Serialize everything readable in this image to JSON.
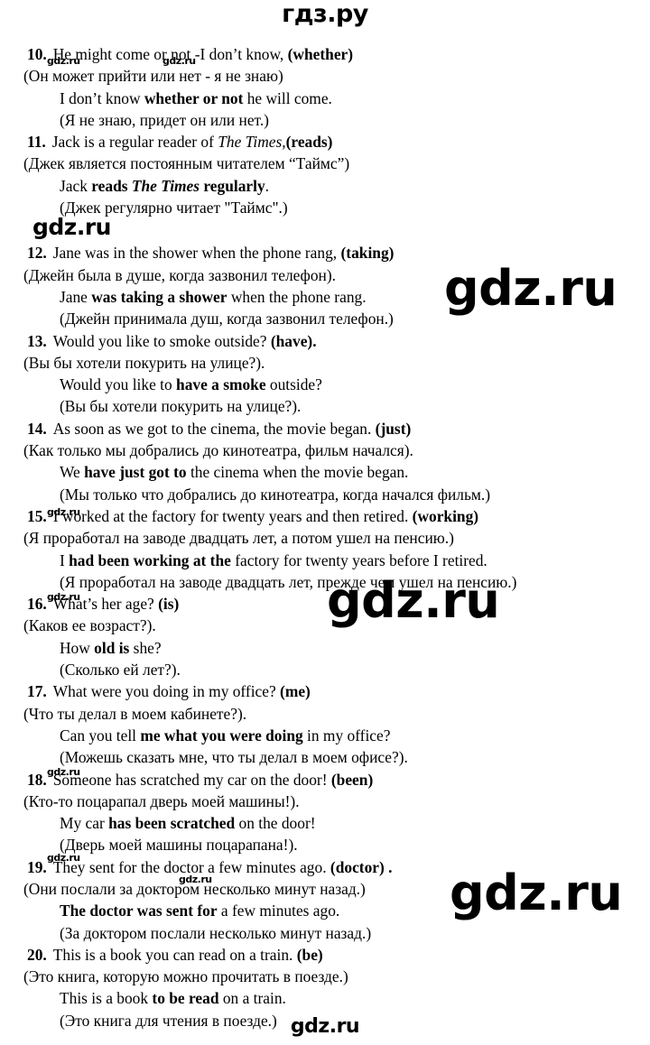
{
  "site": {
    "header_logo": "гдз.ру",
    "footer_logo": "gdz.ru",
    "watermark_text": "gdz.ru"
  },
  "exercises": [
    {
      "number": "10.",
      "prompt_en": "He might come or not -I don’t know,",
      "hint": "(whether)",
      "prompt_ru": "(Он может прийти или нет - я не знаю)",
      "answer_pre": "I don’t know ",
      "answer_bold": "whether or not",
      "answer_post": " he will come.",
      "answer_ru": "(Я не знаю, придет он или нет.)"
    },
    {
      "number": "11.",
      "prompt_en": "Jack is a regular reader of ",
      "prompt_en_italic": "The Times,",
      "hint": "(reads)",
      "prompt_ru": "(Джек является постоянным читателем “Таймс”)",
      "answer_pre": "Jack ",
      "answer_bold": "reads ",
      "answer_bold_italic": "The Times",
      "answer_bold2": " regularly",
      "answer_post": ".",
      "answer_ru": "(Джек регулярно читает \"Таймс\".)"
    },
    {
      "number": "12.",
      "prompt_en": "Jane was in the shower when the phone rang,",
      "hint": "(taking)",
      "prompt_ru": "(Джейн была в душе, когда зазвонил телефон).",
      "answer_pre": "Jane ",
      "answer_bold": "was taking a shower",
      "answer_post": " when the phone rang.",
      "answer_ru": "(Джейн принимала душ, когда зазвонил телефон.)"
    },
    {
      "number": "13.",
      "prompt_en": "Would you like to smoke outside?",
      "hint": "(have).",
      "prompt_ru": "(Вы бы хотели покурить на улице?).",
      "answer_pre": "Would you like to ",
      "answer_bold": "have a smoke",
      "answer_post": " outside?",
      "answer_ru": "(Вы бы хотели покурить на улице?)."
    },
    {
      "number": "14.",
      "prompt_en": "As soon as we got to the cinema, the movie began.",
      "hint": "(just)",
      "prompt_ru": "(Как только мы добрались до кинотеатра, фильм начался).",
      "answer_pre": "We ",
      "answer_bold": "have just got to",
      "answer_post": " the cinema when the movie began.",
      "answer_ru": "(Мы только что добрались до кинотеатра, когда начался фильм.)"
    },
    {
      "number": "15.",
      "prompt_en": "I worked at the factory for twenty years and then retired.",
      "hint": "(working)",
      "prompt_ru": "(Я проработал на заводе двадцать лет, а потом ушел на пенсию.)",
      "answer_pre": "I ",
      "answer_bold": "had been working at the",
      "answer_post": " factory for twenty years before I retired.",
      "answer_ru": "(Я проработал на заводе двадцать лет, прежде чем ушел на пенсию.)"
    },
    {
      "number": "16.",
      "prompt_en": "What’s her age?",
      "hint": "(is)",
      "prompt_ru": "(Каков ее возраст?).",
      "answer_pre": "How ",
      "answer_bold": "old is",
      "answer_post": " she?",
      "answer_ru": "(Сколько ей лет?)."
    },
    {
      "number": "17.",
      "prompt_en": "What were you doing in my office?",
      "hint": "(me)",
      "prompt_ru": "(Что ты делал в моем кабинете?).",
      "answer_pre": "Can you tell ",
      "answer_bold": "me what you were doing",
      "answer_post": " in my office?",
      "answer_ru": "(Можешь сказать мне, что ты делал в моем офисе?)."
    },
    {
      "number": "18.",
      "prompt_en": "Someone has scratched my car on the door!",
      "hint": "(been)",
      "prompt_ru": "(Кто-то поцарапал дверь моей машины!).",
      "answer_pre": "My car ",
      "answer_bold": "has been scratched",
      "answer_post": " on the door!",
      "answer_ru": "(Дверь моей машины поцарапана!)."
    },
    {
      "number": "19.",
      "prompt_en": "They sent for the doctor a few minutes ago.",
      "hint": "(doctor) .",
      "prompt_ru": "(Они послали за доктором несколько минут назад.)",
      "answer_pre": "",
      "answer_bold": "The doctor was sent for",
      "answer_post": " a few minutes ago.",
      "answer_ru": "(За доктором послали несколько минут назад.)"
    },
    {
      "number": "20.",
      "prompt_en": "This is a book you can read on a train.",
      "hint": "(be)",
      "prompt_ru": "(Это книга, которую можно прочитать в поезде.)",
      "answer_pre": "This is a book ",
      "answer_bold": "to be read",
      "answer_post": " on a train.",
      "answer_ru": "(Это книга для чтения в поезде.)"
    }
  ]
}
